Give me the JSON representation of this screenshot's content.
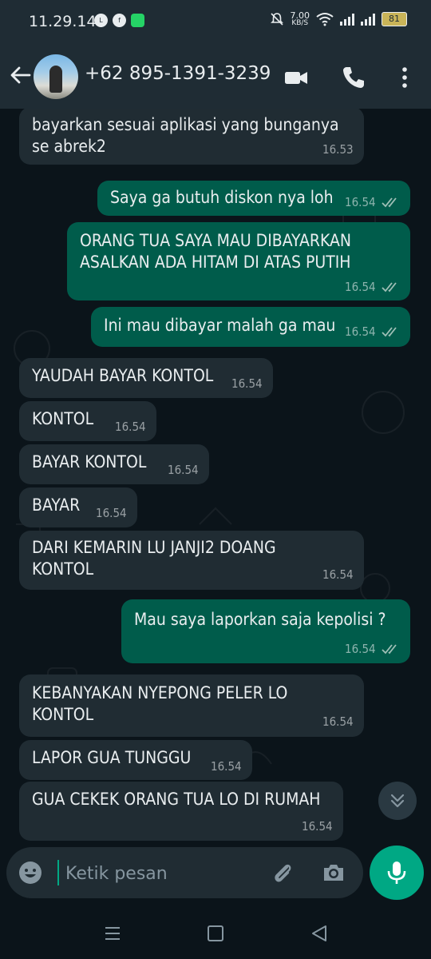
{
  "status_bar": {
    "time": "11.29.14",
    "speed_value": "7.00",
    "speed_unit": "KB/S",
    "battery": "81",
    "left_icons": [
      "line-icon",
      "facebook-icon",
      "chat-app-icon"
    ]
  },
  "header": {
    "contact_name": "+62 895-1391-3239",
    "icons": [
      "back-arrow-icon",
      "video-call-icon",
      "phone-icon",
      "more-vert-icon"
    ]
  },
  "messages": [
    {
      "direction": "in",
      "text": "bayarkan sesuai aplikasi yang bunganya\nse abrek2",
      "time": "16.53"
    },
    {
      "direction": "out",
      "text": "Saya ga butuh diskon nya loh",
      "time": "16.54",
      "status": "read"
    },
    {
      "direction": "out",
      "text": "ORANG TUA SAYA MAU DIBAYARKAN\nASALKAN ADA HITAM DI ATAS PUTIH",
      "time": "16.54",
      "status": "read"
    },
    {
      "direction": "out",
      "text": "Ini mau dibayar malah ga mau",
      "time": "16.54",
      "status": "read"
    },
    {
      "direction": "in",
      "text": "YAUDAH BAYAR KONTOL",
      "time": "16.54"
    },
    {
      "direction": "in",
      "text": "KONTOL",
      "time": "16.54"
    },
    {
      "direction": "in",
      "text": "BAYAR KONTOL",
      "time": "16.54"
    },
    {
      "direction": "in",
      "text": "BAYAR",
      "time": "16.54"
    },
    {
      "direction": "in",
      "text": "DARI KEMARIN LU JANJI2 DOANG\nKONTOL",
      "time": "16.54"
    },
    {
      "direction": "out",
      "text": "Mau saya laporkan saja kepolisi ?",
      "time": "16.54",
      "status": "read"
    },
    {
      "direction": "in",
      "text": "KEBANYAKAN NYEPONG PELER LO\nKONTOL",
      "time": "16.54"
    },
    {
      "direction": "in",
      "text": "LAPOR GUA TUNGGU",
      "time": "16.54"
    },
    {
      "direction": "in",
      "text": "GUA CEKEK ORANG TUA LO DI RUMAH",
      "time": "16.54"
    }
  ],
  "input": {
    "placeholder": "Ketik pesan"
  },
  "colors": {
    "header_bg": "#1f2c34",
    "chat_bg": "#0b141a",
    "incoming_bubble": "#202c33",
    "outgoing_bubble": "#005c4b",
    "accent": "#00a884",
    "read_ticks": "#9fbfb6"
  }
}
